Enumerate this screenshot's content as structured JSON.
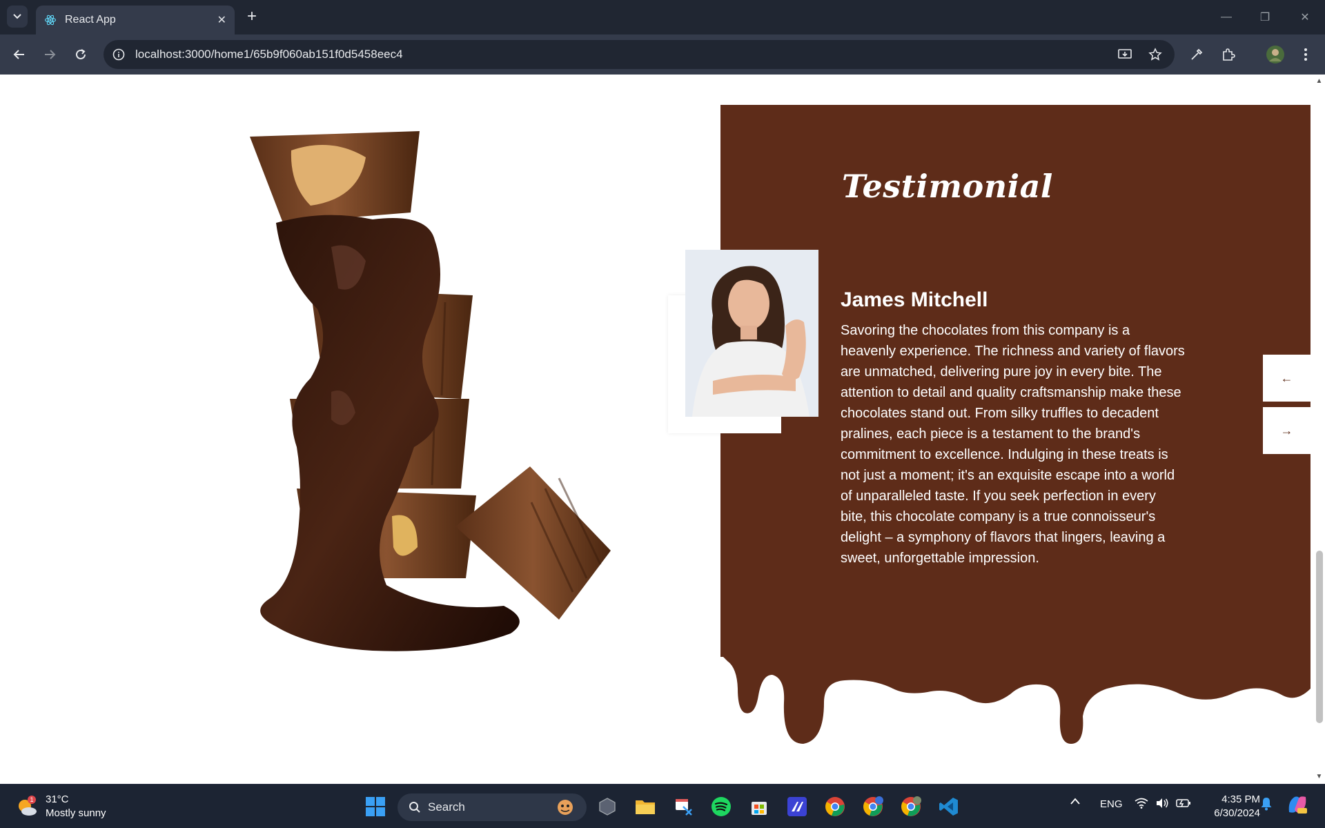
{
  "browser": {
    "tab_title": "React App",
    "url": "localhost:3000/home1/65b9f060ab151f0d5458eec4"
  },
  "testimonial": {
    "heading": "Testimonial",
    "name": "James Mitchell",
    "quote": "Savoring the chocolates from this company is a heavenly experience. The richness and variety of flavors are unmatched, delivering pure joy in every bite. The attention to detail and quality craftsmanship make these chocolates stand out. From silky truffles to decadent pralines, each piece is a testament to the brand's commitment to excellence. Indulging in these treats is not just a moment; it's an exquisite escape into a world of unparalleled taste. If you seek perfection in every bite, this chocolate company is a true connoisseur's delight – a symphony of flavors that lingers, leaving a sweet, unforgettable impression.",
    "prev_arrow": "←",
    "next_arrow": "→"
  },
  "taskbar": {
    "weather_temp": "31°C",
    "weather_desc": "Mostly sunny",
    "weather_badge": "1",
    "search_label": "Search",
    "lang": "ENG",
    "time": "4:35 PM",
    "date": "6/30/2024"
  },
  "colors": {
    "panel": "#5e2c19",
    "chrome": "#202632",
    "toolbar": "#343b4b"
  }
}
